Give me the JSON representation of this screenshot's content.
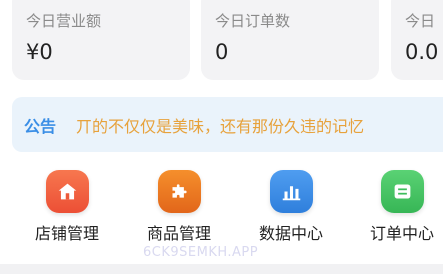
{
  "stats": [
    {
      "label": "今日营业额",
      "value": "¥0"
    },
    {
      "label": "今日订单数",
      "value": "0"
    },
    {
      "label": "今日",
      "value": "0.0"
    }
  ],
  "notice": {
    "label": "公告",
    "text": "丌的不仅仅是美味，还有那份久违的记忆"
  },
  "menu": [
    {
      "label": "店铺管理",
      "icon": "shop-icon",
      "color": "#f0603e"
    },
    {
      "label": "商品管理",
      "icon": "puzzle-icon",
      "color": "#f07a1f"
    },
    {
      "label": "数据中心",
      "icon": "bar-chart-icon",
      "color": "#3c8de6"
    },
    {
      "label": "订单中心",
      "icon": "order-icon",
      "color": "#46c463"
    }
  ],
  "watermark": "6CK9SEMKH.APP",
  "colors": {
    "card_bg": "#f3f3f5",
    "notice_bg": "#eaf3fb",
    "notice_label": "#3a8ee6",
    "notice_text": "#e7a23c"
  }
}
